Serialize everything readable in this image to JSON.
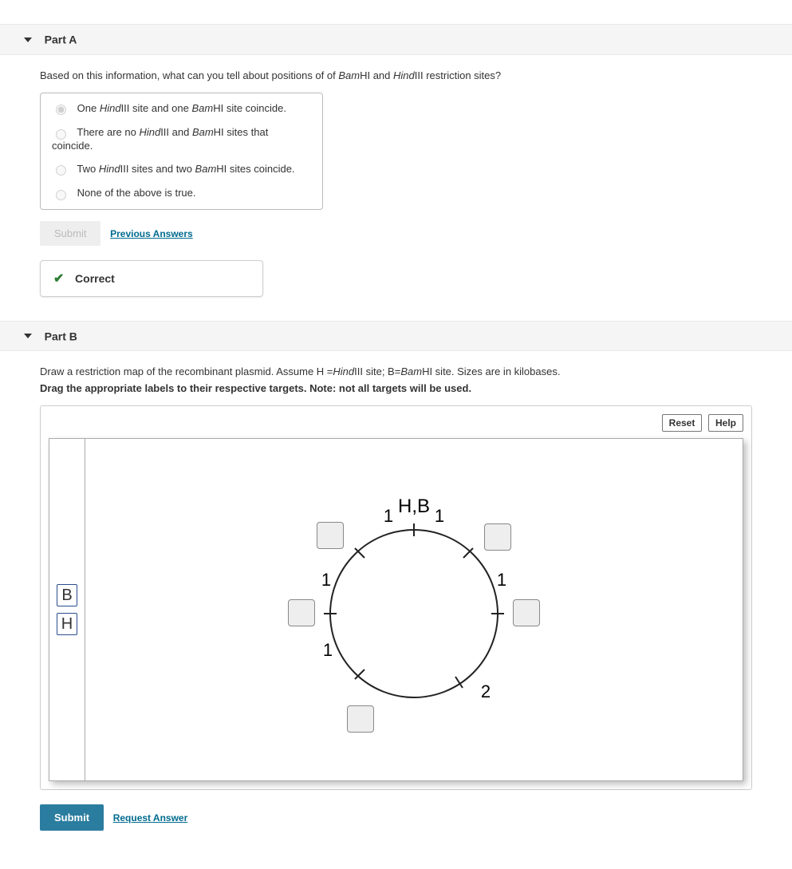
{
  "partA": {
    "title": "Part A",
    "question_pre": "Based on this information, what can you tell about positions of of ",
    "q_bam_i": "Bam",
    "q_bam": "HI and ",
    "q_hind_i": "Hind",
    "q_hind": "III restriction sites?",
    "options": {
      "o1_pre": "One ",
      "hind_i": "Hind",
      "o1_mid": "III site and one ",
      "bam_i": "Bam",
      "o1_post": "HI site coincide.",
      "o2_pre": "There are no ",
      "o2_mid": "III and ",
      "o2_post": "HI sites that coincide.",
      "o3_pre": "Two ",
      "o3_mid": "III sites and two ",
      "o3_post": "HI sites coincide.",
      "o4": "None of the above is true."
    },
    "submit": "Submit",
    "prev": "Previous Answers",
    "correct": "Correct"
  },
  "partB": {
    "title": "Part B",
    "instr_pre": "Draw a restriction map of the recombinant plasmid. Assume H =",
    "instr_hind_i": "Hind",
    "instr_mid": "III site; B=",
    "instr_bam_i": "Bam",
    "instr_post": "HI site. Sizes are in kilobases.",
    "instr2": "Drag the appropriate labels to their respective targets. Note: not all targets will be used.",
    "reset": "Reset",
    "help": "Help",
    "pal_B": "B",
    "pal_H": "H",
    "submit": "Submit",
    "req": "Request Answer",
    "labels": {
      "top": "H,B",
      "n1a": "1",
      "n1b": "1",
      "n1c": "1",
      "n1d": "1",
      "n1e": "1",
      "n2": "2"
    }
  }
}
